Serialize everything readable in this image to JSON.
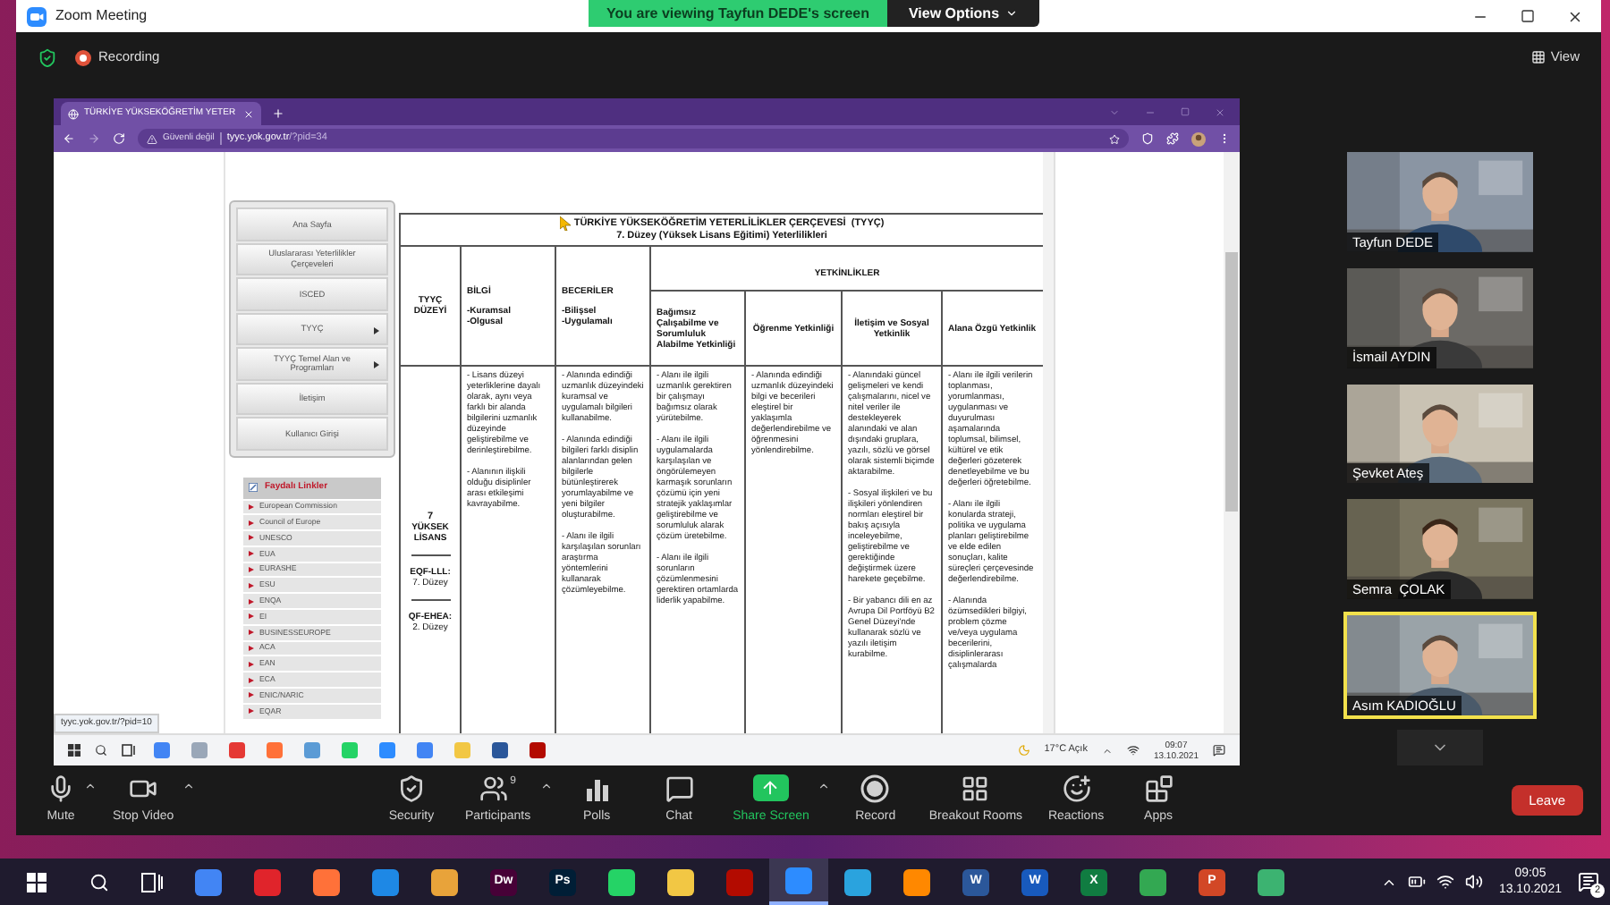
{
  "window": {
    "title": "Zoom Meeting"
  },
  "share_banner": {
    "text": "You are viewing Tayfun DEDE's screen",
    "view_options": "View Options"
  },
  "meeting_bar": {
    "recording": "Recording",
    "view": "View"
  },
  "browser": {
    "tab_title": "TÜRKİYE YÜKSEKÖĞRETİM YETER",
    "security": "Güvenli değil",
    "host": "tyyc.yok.gov.tr",
    "path": "/?pid=34",
    "status_url": "tyyc.yok.gov.tr/?pid=10"
  },
  "sidebar": {
    "menu": [
      {
        "label": "Ana Sayfa",
        "submenu": false
      },
      {
        "label": "Uluslararası Yeterlilikler Çerçeveleri",
        "submenu": false
      },
      {
        "label": "ISCED",
        "submenu": false
      },
      {
        "label": "TYYÇ",
        "submenu": true
      },
      {
        "label": "TYYÇ Temel Alan ve Programları",
        "submenu": true
      },
      {
        "label": "İletişim",
        "submenu": false
      },
      {
        "label": "Kullanıcı Girişi",
        "submenu": false
      }
    ],
    "links_title": "Faydalı Linkler",
    "links": [
      "European Commission",
      "Council of Europe",
      "UNESCO",
      "EUA",
      "EURASHE",
      "ESU",
      "ENQA",
      "EI",
      "BUSINESSEUROPE",
      "ACA",
      "EAN",
      "ECA",
      "ENIC/NARIC",
      "EQAR"
    ]
  },
  "table": {
    "title": "TÜRKİYE YÜKSEKÖĞRETİM YETERLİLİKLER ÇERÇEVESİ  (TYYÇ)",
    "subtitle": "7. Düzey (Yüksek Lisans Eğitimi) Yeterlilikleri",
    "group_header": "YETKİNLİKLER",
    "columns": [
      {
        "title": "TYYÇ DÜZEYİ"
      },
      {
        "title": "BİLGİ",
        "lines": [
          "-Kuramsal",
          "-Olgusal"
        ]
      },
      {
        "title": "BECERİLER",
        "lines": [
          "-Bilişsel",
          "-Uygulamalı"
        ]
      },
      {
        "title": "Bağımsız Çalışabilme ve Sorumluluk Alabilme Yetkinliği"
      },
      {
        "title": "Öğrenme Yetkinliği"
      },
      {
        "title": "İletişim ve Sosyal Yetkinlik"
      },
      {
        "title": "Alana Özgü Yetkinlik"
      }
    ],
    "level": {
      "number": "7",
      "name": "YÜKSEK LİSANS",
      "refs": [
        {
          "label": "EQF-LLL:",
          "value": "7. Düzey"
        },
        {
          "label": "QF-EHEA:",
          "value": "2. Düzey"
        }
      ]
    },
    "cells": [
      [
        "- Lisans düzeyi yeterliklerine dayalı olarak, aynı veya farklı bir alanda bilgilerini uzmanlık düzeyinde geliştirebilme ve derinleştirebilme.",
        "- Alanının ilişkili olduğu disiplinler arası etkileşimi kavrayabilme."
      ],
      [
        "- Alanında edindiği uzmanlık düzeyindeki kuramsal ve uygulamalı bilgileri kullanabilme.",
        "- Alanında edindiği bilgileri farklı disiplin alanlarından gelen bilgilerle bütünleştirerek yorumlayabilme ve yeni bilgiler oluşturabilme.",
        "- Alanı ile ilgili karşılaşılan sorunları araştırma yöntemlerini kullanarak çözümleyebilme."
      ],
      [
        "- Alanı ile ilgili uzmanlık gerektiren bir çalışmayı bağımsız olarak yürütebilme.",
        "- Alanı ile ilgili uygulamalarda karşılaşılan ve öngörülemeyen karmaşık sorunların çözümü için yeni stratejik yaklaşımlar geliştirebilme ve sorumluluk alarak çözüm üretebilme.",
        "- Alanı ile ilgili sorunların çözümlenmesini gerektiren ortamlarda liderlik yapabilme."
      ],
      [
        "- Alanında edindiği uzmanlık düzeyindeki bilgi ve becerileri eleştirel bir yaklaşımla değerlendirebilme ve öğrenmesini yönlendirebilme."
      ],
      [
        "- Alanındaki güncel gelişmeleri ve kendi çalışmalarını, nicel ve nitel veriler ile destekleyerek alanındaki ve alan dışındaki gruplara, yazılı, sözlü ve görsel olarak sistemli biçimde aktarabilme.",
        "- Sosyal ilişkileri ve bu ilişkileri yönlendiren normları eleştirel bir bakış açısıyla inceleyebilme, geliştirebilme ve gerektiğinde değiştirmek üzere harekete geçebilme.",
        "- Bir yabancı dili en az Avrupa Dil Portföyü B2 Genel Düzeyi'nde kullanarak sözlü ve yazılı iletişim kurabilme."
      ],
      [
        "- Alanı ile ilgili verilerin toplanması, yorumlanması, uygulanması ve duyurulması aşamalarında toplumsal, bilimsel, kültürel ve etik değerleri gözeterek denetleyebilme ve bu değerleri öğretebilme.",
        "- Alanı ile ilgili konularda strateji, politika ve uygulama planları geliştirebilme ve elde edilen sonuçları, kalite süreçleri çerçevesinde değerlendirebilme.",
        "- Alanında özümsedikleri bilgiyi, problem çözme ve/veya uygulama becerilerini, disiplinlerarası çalışmalarda"
      ]
    ]
  },
  "shared_taskbar": {
    "apps": [
      {
        "color": "#4285f4"
      },
      {
        "color": "#9aa7b8"
      },
      {
        "color": "#e53935"
      },
      {
        "color": "#ff7139"
      },
      {
        "color": "#5b9bd5"
      },
      {
        "color": "#25d366"
      },
      {
        "color": "#2d8cff"
      },
      {
        "color": "#4285f4"
      },
      {
        "color": "#f2c744"
      },
      {
        "color": "#2b579a"
      },
      {
        "color": "#b30b00"
      }
    ],
    "weather": "17°C Açık",
    "time": "09:07",
    "date": "13.10.2021"
  },
  "participants": [
    {
      "name": "Tayfun DEDE",
      "active": false
    },
    {
      "name": "İsmail AYDIN",
      "active": false
    },
    {
      "name": "Şevket Ateş",
      "active": false
    },
    {
      "name": "Semra  ÇOLAK",
      "active": false
    },
    {
      "name": "Asım KADIOĞLU",
      "active": true
    }
  ],
  "toolbar": [
    {
      "kind": "mic",
      "label": "Mute",
      "caret": true
    },
    {
      "kind": "video",
      "label": "Stop Video",
      "caret": true
    },
    {
      "kind": "security",
      "label": "Security",
      "caret": false
    },
    {
      "kind": "participants",
      "label": "Participants",
      "badge": "9",
      "caret": true
    },
    {
      "kind": "polls",
      "label": "Polls",
      "caret": false
    },
    {
      "kind": "chat",
      "label": "Chat",
      "caret": false
    },
    {
      "kind": "share",
      "label": "Share Screen",
      "caret": true
    },
    {
      "kind": "record",
      "label": "Record",
      "caret": false
    },
    {
      "kind": "breakout",
      "label": "Breakout Rooms",
      "caret": false
    },
    {
      "kind": "reactions",
      "label": "Reactions",
      "caret": false
    },
    {
      "kind": "apps",
      "label": "Apps",
      "caret": false
    }
  ],
  "leave": "Leave",
  "taskbar": {
    "apps": [
      {
        "color": "#4285f4",
        "selected": false
      },
      {
        "color": "#e0242b",
        "selected": false
      },
      {
        "color": "#ff7139",
        "selected": false
      },
      {
        "color": "#1e88e5",
        "selected": false
      },
      {
        "color": "#e8a33a",
        "selected": false
      },
      {
        "color": "#470137",
        "label": "Dw",
        "selected": false
      },
      {
        "color": "#001e36",
        "label": "Ps",
        "selected": false
      },
      {
        "color": "#25d366",
        "selected": false
      },
      {
        "color": "#f2c744",
        "selected": false
      },
      {
        "color": "#b30b00",
        "selected": false
      },
      {
        "color": "#2d8cff",
        "selected": true
      },
      {
        "color": "#2aa3de",
        "selected": false
      },
      {
        "color": "#ff8800",
        "selected": false
      },
      {
        "color": "#2b579a",
        "label": "W",
        "selected": false
      },
      {
        "color": "#185abd",
        "label": "W",
        "selected": false
      },
      {
        "color": "#107c41",
        "label": "X",
        "selected": false
      },
      {
        "color": "#33a852",
        "selected": false
      },
      {
        "color": "#d24726",
        "label": "P",
        "selected": false
      },
      {
        "color": "#3cb371",
        "selected": false
      }
    ],
    "time": "09:05",
    "date": "13.10.2021",
    "notifications": "2"
  }
}
